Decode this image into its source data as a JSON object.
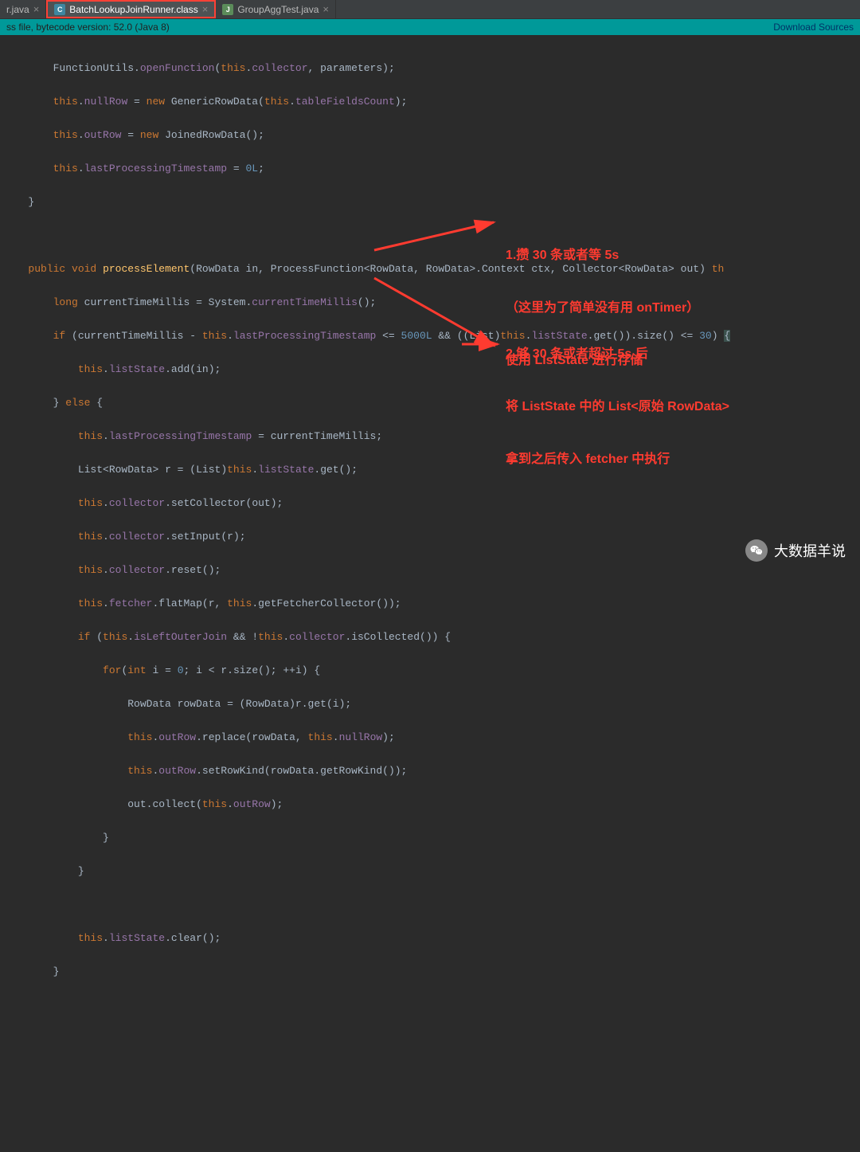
{
  "tabs": {
    "left": {
      "label": "r.java"
    },
    "active": {
      "label": "BatchLookupJoinRunner.class"
    },
    "right": {
      "label": "GroupAggTest.java"
    }
  },
  "info_bar": {
    "left": "ss file, bytecode version: 52.0 (Java 8)",
    "right": "Download Sources"
  },
  "kw": {
    "this": "this",
    "new": "new",
    "public": "public",
    "void": "void",
    "long": "long",
    "if": "if",
    "else": "else",
    "for": "for",
    "int": "int"
  },
  "code": {
    "l1_class": "FunctionUtils",
    "l1_m": "openFunction",
    "l1_fld": "collector",
    "l1_par": "parameters",
    "l2_fld": "nullRow",
    "l2_class": "GenericRowData",
    "l2_fld2": "tableFieldsCount",
    "l3_fld": "outRow",
    "l3_class": "JoinedRowData",
    "l4_fld": "lastProcessingTimestamp",
    "l4_val": "0L",
    "m_name": "processElement",
    "m_p1t": "RowData",
    "m_p1": "in",
    "m_p2t": "ProcessFunction<RowData, RowData>.Context",
    "m_p2": "ctx",
    "m_p3t1": "Collector<",
    "m_p3t2": "RowData",
    "m_p3t3": ">",
    "m_p3": "out",
    "m_th": "th",
    "l6_var": "currentTimeMillis",
    "l6_class": "System",
    "l6_m": "currentTimeMillis",
    "l7_var1": "currentTimeMillis",
    "l7_fld": "lastProcessingTimestamp",
    "l7_num1": "5000L",
    "l7_cast": "List",
    "l7_fld2": "listState",
    "l7_m1": "get",
    "l7_m2": "size",
    "l7_num2": "30",
    "l8_fld": "listState",
    "l8_m": "add",
    "l8_par": "in",
    "l10_fld": "lastProcessingTimestamp",
    "l10_var": "currentTimeMillis",
    "l11_t": "List<RowData>",
    "l11_var": "r",
    "l11_cast": "List",
    "l11_fld": "listState",
    "l11_m": "get",
    "l12_fld": "collector",
    "l12_m": "setCollector",
    "l12_par": "out",
    "l13_fld": "collector",
    "l13_m": "setInput",
    "l13_par": "r",
    "l14_fld": "collector",
    "l14_m": "reset",
    "l15_fld": "fetcher",
    "l15_m": "flatMap",
    "l15_par1": "r",
    "l15_m2": "getFetcherCollector",
    "l16_fld1": "isLeftOuterJoin",
    "l16_fld2": "collector",
    "l16_m": "isCollected",
    "l17_var": "i",
    "l17_num": "0",
    "l17_var2": "i",
    "l17_par": "r",
    "l17_m": "size",
    "l17_var3": "i",
    "l18_t": "RowData",
    "l18_var": "rowData",
    "l18_cast": "RowData",
    "l18_par": "r",
    "l18_m": "get",
    "l18_par2": "i",
    "l19_fld": "outRow",
    "l19_m": "replace",
    "l19_par1": "rowData",
    "l19_fld2": "nullRow",
    "l20_fld": "outRow",
    "l20_m": "setRowKind",
    "l20_par": "rowData",
    "l20_m2": "getRowKind",
    "l21_par": "out",
    "l21_m": "collect",
    "l21_fld": "outRow",
    "l24_fld": "listState",
    "l24_m": "clear"
  },
  "ann1": {
    "l1": "1.攒 30 条或者等 5s",
    "l2": "（这里为了简单没有用 onTimer）",
    "l3": "使用 ListState 进行存储"
  },
  "ann2": {
    "l1": "2.够 30 条或者超过 5s 后",
    "l2": "将 ListState 中的 List<原始 RowData>",
    "l3": "拿到之后传入 fetcher 中执行"
  },
  "watermark": {
    "text": "大数据羊说"
  }
}
